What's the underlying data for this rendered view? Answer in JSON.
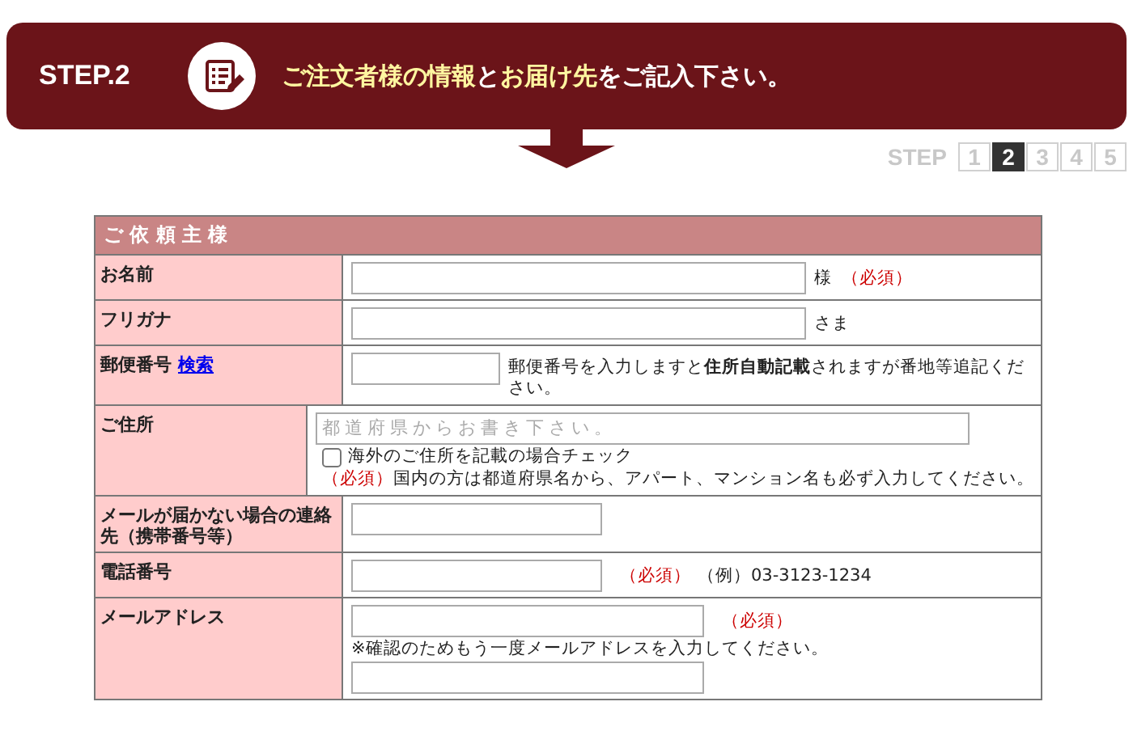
{
  "banner": {
    "step_label": "STEP.2",
    "heading": [
      {
        "text": "ご注文者様の情報",
        "highlight": true
      },
      {
        "text": "と",
        "highlight": false
      },
      {
        "text": "お届け先",
        "highlight": true
      },
      {
        "text": "をご記入下さい。",
        "highlight": false
      }
    ]
  },
  "progress": {
    "label": "STEP",
    "steps": [
      {
        "label": "1",
        "selected": false
      },
      {
        "label": "2",
        "selected": true
      },
      {
        "label": "3",
        "selected": false
      },
      {
        "label": "4",
        "selected": false
      },
      {
        "label": "5",
        "selected": false
      }
    ]
  },
  "form": {
    "title": "ご 依 頼 主 様",
    "rows": [
      {
        "label": "お名前",
        "lines": [
          [
            {
              "kind": "input"
            },
            {
              "kind": "text",
              "text": "様"
            },
            {
              "kind": "required",
              "text": "（必須）"
            }
          ]
        ]
      },
      {
        "label": "フリガナ",
        "lines": [
          [
            {
              "kind": "input"
            },
            {
              "kind": "text",
              "text": "さま"
            }
          ]
        ]
      },
      {
        "label": "郵便番号",
        "link": "検索",
        "lines": [
          [
            {
              "kind": "input"
            },
            {
              "kind": "note",
              "text": "郵便番号を入力しますと**住所自動記載**されますが番地等追記ください。"
            }
          ]
        ]
      },
      {
        "label": "ご住所",
        "lines": [
          [
            {
              "kind": "input",
              "placeholder": "都道府県からお書き下さい。"
            }
          ],
          [
            {
              "kind": "checkbox",
              "checked": false,
              "text": "海外のご住所を記載の場合チェック"
            }
          ],
          [
            {
              "kind": "required",
              "text": "（必須）"
            },
            {
              "kind": "text",
              "text": "国内の方は都道府県名から、アパート、マンション名も必ず入力してください。"
            }
          ]
        ]
      },
      {
        "label": "メールが届かない場合の連絡先（携帯番号等）",
        "lines": [
          [
            {
              "kind": "input"
            }
          ]
        ]
      },
      {
        "label": "電話番号",
        "lines": [
          [
            {
              "kind": "input"
            },
            {
              "kind": "required",
              "text": "（必須）"
            },
            {
              "kind": "text",
              "text": "（例）03-3123-1234"
            }
          ]
        ]
      },
      {
        "label": "メールアドレス",
        "lines": [
          [
            {
              "kind": "input"
            },
            {
              "kind": "required",
              "text": "（必須）"
            }
          ],
          [
            {
              "kind": "text",
              "text": "※確認のためもう一度メールアドレスを入力してください。"
            }
          ],
          [
            {
              "kind": "input"
            }
          ]
        ]
      }
    ]
  }
}
